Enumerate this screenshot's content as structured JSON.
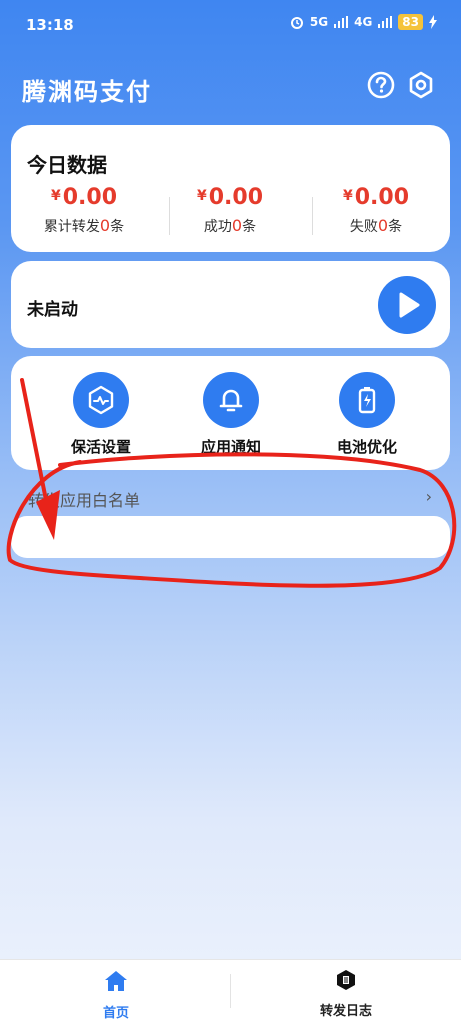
{
  "status_bar": {
    "time": "13:18",
    "network": "5G",
    "network2": "4G",
    "battery": "83"
  },
  "header": {
    "title": "腾渊码支付",
    "help_icon": "question-circle-icon",
    "settings_icon": "hexagon-settings-icon"
  },
  "today": {
    "title": "今日数据",
    "currency": "¥",
    "stats": [
      {
        "amount": "0.00",
        "label_prefix": "累计转发",
        "count": "0",
        "unit": "条"
      },
      {
        "amount": "0.00",
        "label_prefix": "成功",
        "count": "0",
        "unit": "条"
      },
      {
        "amount": "0.00",
        "label_prefix": "失败",
        "count": "0",
        "unit": "条"
      }
    ]
  },
  "service": {
    "status": "未启动",
    "icon": "play-icon"
  },
  "tools": [
    {
      "label": "保活设置",
      "icon": "keepalive-hexagon-icon"
    },
    {
      "label": "应用通知",
      "icon": "bell-icon"
    },
    {
      "label": "电池优化",
      "icon": "battery-icon"
    }
  ],
  "whitelist": {
    "title": "转发应用白名单",
    "chevron": "›"
  },
  "nav": [
    {
      "label": "首页",
      "icon": "home-icon",
      "active": true
    },
    {
      "label": "转发日志",
      "icon": "log-icon",
      "active": false
    }
  ],
  "colors": {
    "accent": "#2f7cf0",
    "amount": "#e53b2c",
    "annotation": "#e8231a"
  }
}
